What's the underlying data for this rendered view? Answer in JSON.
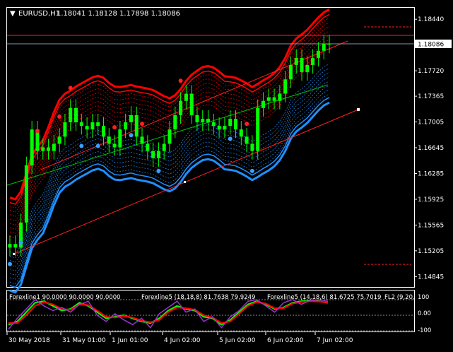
{
  "header": {
    "symbol": "EURUSD,H1",
    "ohlc": "1.18041 1.18128 1.17898 1.18086"
  },
  "price_axis": {
    "ticks": [
      "1.18440",
      "1.18086",
      "1.17720",
      "1.17365",
      "1.17005",
      "1.16645",
      "1.16285",
      "1.15925",
      "1.15565",
      "1.15205",
      "1.14845"
    ],
    "current_price": "1.18086"
  },
  "time_axis": {
    "ticks": [
      "30 May 2018",
      "31 May 01:00",
      "1 Jun 01:00",
      "4 Jun 02:00",
      "5 Jun 02:00",
      "6 Jun 02:00",
      "7 Jun 02:00"
    ]
  },
  "indicator": {
    "label_a": "Forexline1 90.0000 90.0000 90.0000",
    "label_b": "Forexline5 (18,18,8) 81.7638 79.9249",
    "label_c": "Forexline5 (14,18,6) 81.6725 75.7019",
    "label_d": "FL2 (9,20,",
    "levels": [
      "100",
      "0.00",
      "-100"
    ]
  },
  "colors": {
    "background": "#000000",
    "bull_candle": "#00ff00",
    "upper_band": "#ff0000",
    "lower_band": "#1e90ff",
    "mid_line": "#00c000",
    "trend_line": "#ff2020",
    "axis": "#ffffff"
  },
  "chart_data": {
    "type": "candlestick",
    "symbol": "EURUSD",
    "timeframe": "H1",
    "ylim": [
      1.147,
      1.186
    ],
    "ohlc_last": {
      "open": 1.18041,
      "high": 1.18128,
      "low": 1.17898,
      "close": 1.18086
    },
    "close_series": [
      1.153,
      1.1525,
      1.156,
      1.164,
      1.169,
      1.166,
      1.1665,
      1.166,
      1.167,
      1.168,
      1.17,
      1.172,
      1.17,
      1.1695,
      1.169,
      1.17,
      1.1695,
      1.168,
      1.167,
      1.1665,
      1.169,
      1.17,
      1.171,
      1.168,
      1.167,
      1.166,
      1.165,
      1.166,
      1.167,
      1.169,
      1.171,
      1.173,
      1.174,
      1.171,
      1.17,
      1.1705,
      1.17,
      1.1695,
      1.169,
      1.1695,
      1.1705,
      1.169,
      1.168,
      1.167,
      1.166,
      1.172,
      1.173,
      1.1735,
      1.173,
      1.174,
      1.176,
      1.178,
      1.179,
      1.177,
      1.178,
      1.179,
      1.18,
      1.181,
      1.18086
    ],
    "indicator_series": [
      {
        "color": "#00ff00",
        "values": [
          -60,
          -40,
          20,
          80,
          90,
          60,
          30,
          40,
          80,
          60,
          20,
          -20,
          -10,
          0,
          -20,
          -40,
          -50,
          -20,
          30,
          60,
          40,
          30,
          -10,
          -20,
          -60,
          -30,
          20,
          70,
          90,
          70,
          40,
          50,
          80,
          90,
          95,
          90,
          80
        ]
      },
      {
        "color": "#ff0000",
        "values": [
          -50,
          -50,
          0,
          60,
          85,
          70,
          40,
          35,
          70,
          65,
          30,
          -10,
          -15,
          -5,
          -15,
          -35,
          -45,
          -30,
          20,
          50,
          45,
          35,
          0,
          -15,
          -50,
          -40,
          10,
          60,
          85,
          75,
          45,
          45,
          75,
          85,
          90,
          88,
          82
        ]
      },
      {
        "color": "#9933cc",
        "values": [
          -90,
          -20,
          40,
          100,
          60,
          30,
          50,
          20,
          70,
          90,
          0,
          -40,
          10,
          -30,
          -60,
          -20,
          -80,
          10,
          50,
          90,
          20,
          40,
          -40,
          -10,
          -80,
          -10,
          30,
          90,
          100,
          60,
          20,
          80,
          100,
          70,
          95,
          100,
          90
        ]
      }
    ]
  }
}
